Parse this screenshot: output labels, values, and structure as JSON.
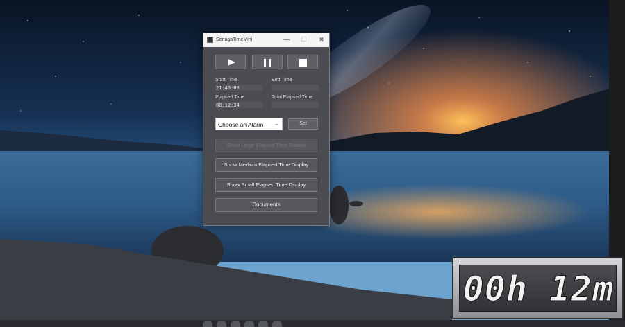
{
  "window": {
    "title": "SenagaTimeMini",
    "minimize_glyph": "—",
    "maximize_glyph": "☐",
    "close_glyph": "✕",
    "icon": "app-icon"
  },
  "controls": {
    "play_icon": "play-icon",
    "pause_icon": "pause-icon",
    "stop_icon": "stop-icon"
  },
  "times": {
    "start_label": "Start Time",
    "start_value": "21:48:00",
    "end_label": "End Time",
    "end_value": "",
    "elapsed_label": "Elapsed Time",
    "elapsed_value": "00:12:34",
    "total_label": "Total Elapsed Time",
    "total_value": ""
  },
  "alarm": {
    "selected": "Choose an Alarm",
    "chevron": "⌄",
    "set_label": "Set"
  },
  "buttons": {
    "large": "Show Large Elapsed Time Display",
    "medium": "Show Medium Elapsed Time Display",
    "small": "Show Small Elapsed Time Display",
    "documents": "Documents"
  },
  "lcd": {
    "text": "00h 12m"
  },
  "colors": {
    "window_bg": "#4b4c51",
    "titlebar_bg": "#f5f5f5",
    "button_bg": "#5f6065"
  }
}
